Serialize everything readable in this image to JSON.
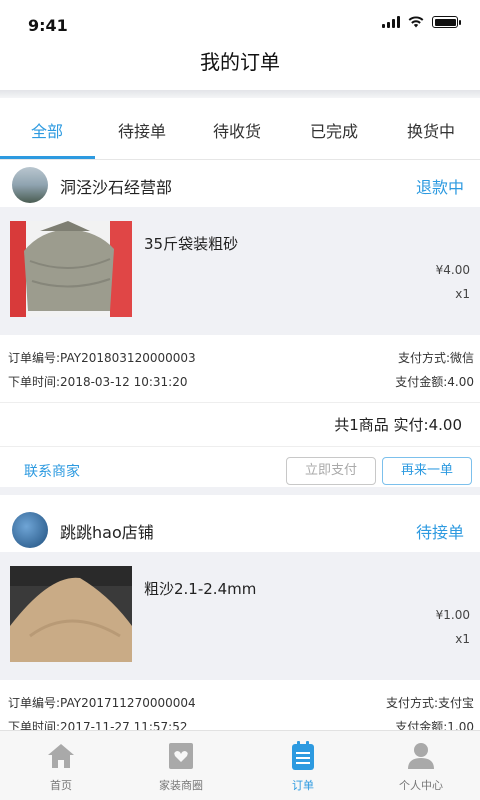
{
  "status_bar": {
    "time": "9:41"
  },
  "nav": {
    "title": "我的订单"
  },
  "tabs": [
    {
      "label": "全部"
    },
    {
      "label": "待接单"
    },
    {
      "label": "待收货"
    },
    {
      "label": "已完成"
    },
    {
      "label": "换货中"
    }
  ],
  "orders": [
    {
      "shop": "洞泾沙石经营部",
      "status": "退款中",
      "product": "35斤袋装粗砂",
      "price": "¥4.00",
      "qty": "x1",
      "order_no": "订单编号:PAY201803120000003",
      "pay_method": "支付方式:微信",
      "time": "下单时间:2018-03-12 10:31:20",
      "pay_amount": "支付金额:4.00",
      "total": "共1商品  实付:4.00",
      "contact": "联系商家",
      "pay_btn": "立即支付",
      "again_btn": "再来一单"
    },
    {
      "shop": "跳跳hao店铺",
      "status": "待接单",
      "product": "粗沙2.1-2.4mm",
      "price": "¥1.00",
      "qty": "x1",
      "order_no": "订单编号:PAY201711270000004",
      "pay_method": "支付方式:支付宝",
      "time": "下单时间:2017-11-27 11:57:52",
      "pay_amount": "支付金额:1.00"
    }
  ],
  "tabbar": [
    {
      "label": "首页",
      "icon": "home-icon"
    },
    {
      "label": "家装商圈",
      "icon": "shop-circle-icon"
    },
    {
      "label": "订单",
      "icon": "order-icon"
    },
    {
      "label": "个人中心",
      "icon": "person-icon"
    }
  ],
  "colors": {
    "accent": "#2d9ae0",
    "bg": "#f0f1f5"
  }
}
